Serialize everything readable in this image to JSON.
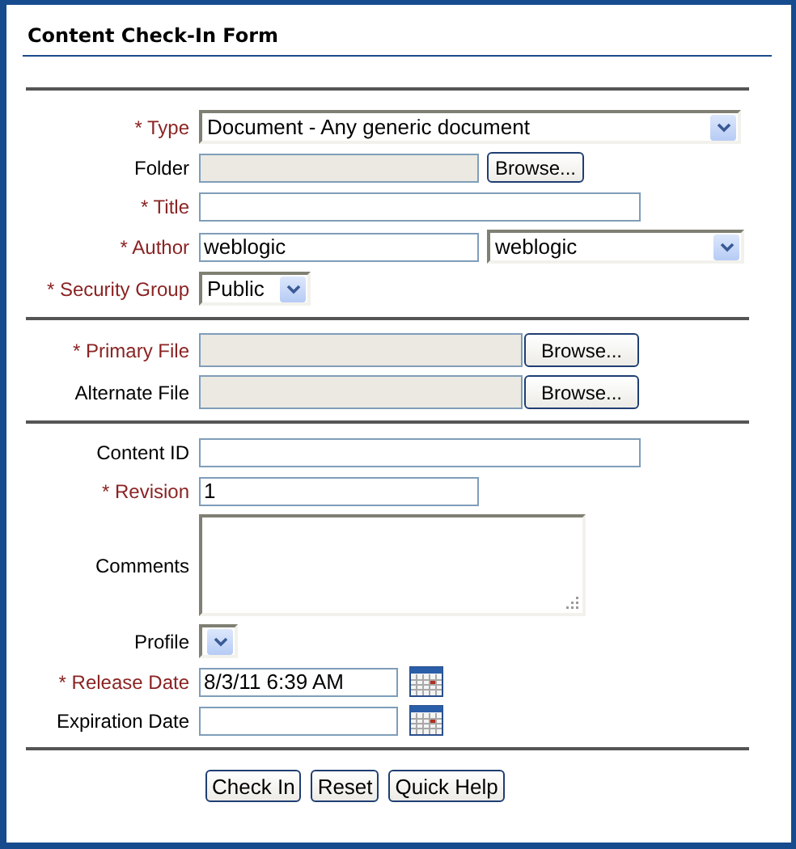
{
  "title": "Content Check-In Form",
  "sections": [
    {
      "rows": [
        {
          "kind": "select",
          "label": "* Type",
          "required": true,
          "value": "Document - Any generic document"
        },
        {
          "kind": "browse",
          "label": "Folder",
          "required": false,
          "button": "Browse..."
        },
        {
          "kind": "text",
          "label": "* Title",
          "required": true
        },
        {
          "kind": "text-select",
          "label": "* Author",
          "required": true,
          "value": "weblogic",
          "choice": "weblogic"
        },
        {
          "kind": "small-select",
          "label": "* Security Group",
          "required": true,
          "value": "Public"
        }
      ]
    },
    {
      "rows": [
        {
          "kind": "file",
          "label": "* Primary File",
          "required": true,
          "button": "Browse..."
        },
        {
          "kind": "file",
          "label": "Alternate File",
          "required": false,
          "button": "Browse..."
        }
      ]
    },
    {
      "rows": [
        {
          "kind": "text",
          "label": "Content ID",
          "required": false
        },
        {
          "kind": "short-text",
          "label": "* Revision",
          "required": true,
          "value": "1"
        },
        {
          "kind": "textarea",
          "label": "Comments",
          "required": false
        },
        {
          "kind": "small-select",
          "label": "Profile",
          "required": false
        },
        {
          "kind": "date",
          "label": "* Release Date",
          "required": true,
          "value": "8/3/11 6:39 AM"
        },
        {
          "kind": "date",
          "label": "Expiration Date",
          "required": false
        }
      ]
    }
  ],
  "buttons": [
    "Check In",
    "Reset",
    "Quick Help"
  ]
}
